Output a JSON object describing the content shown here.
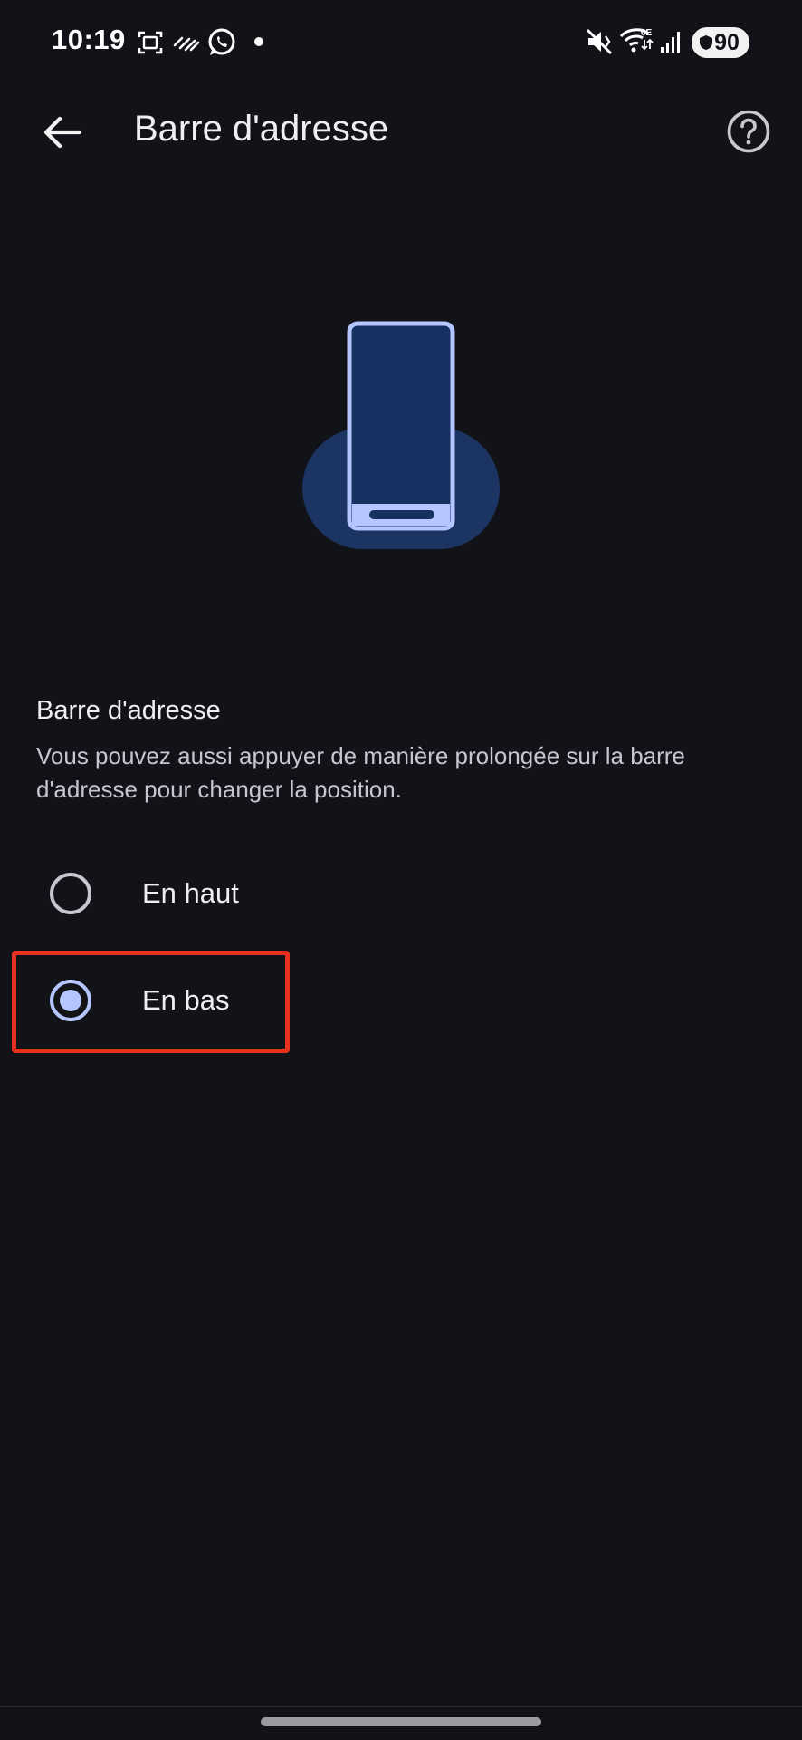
{
  "status_bar": {
    "time": "10:19",
    "battery": "90",
    "icons": [
      "screenshot-icon",
      "sync-icon",
      "whatsapp-icon",
      "notification-dot-icon",
      "vibrate-mute-icon",
      "wifi-6e-icon",
      "cell-signal-icon",
      "battery-icon"
    ]
  },
  "app_bar": {
    "title": "Barre d'adresse",
    "back_icon": "arrow-back-icon",
    "help_icon": "help-circle-icon"
  },
  "section": {
    "title": "Barre d'adresse",
    "description": "Vous pouvez aussi appuyer de manière prolongée sur la barre d'adresse pour changer la position."
  },
  "options": [
    {
      "label": "En haut",
      "selected": false
    },
    {
      "label": "En bas",
      "selected": true
    }
  ],
  "colors": {
    "background": "#121318",
    "accent": "#b4c5ff",
    "illustration_bg": "#1b3462",
    "highlight": "#e8301f"
  }
}
